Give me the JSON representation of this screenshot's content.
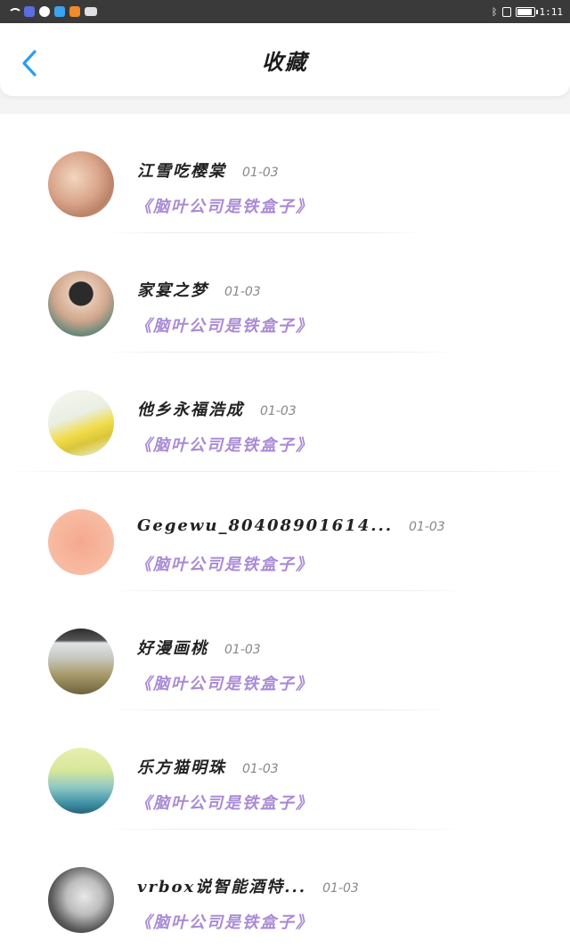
{
  "status_bar": {
    "time": "1:11",
    "app_icons": [
      "#5b6de0",
      "#ffffff",
      "#3aa4f0",
      "#f08a2a",
      "#e0e0e0"
    ]
  },
  "header": {
    "title": "收藏",
    "back_icon": "chevron-left-icon",
    "accent": "#2a9df4"
  },
  "favorites": [
    {
      "name": "江雪吃樱棠",
      "date": "01-03",
      "book": "《脑叶公司是铁盒子》"
    },
    {
      "name": "家宴之梦",
      "date": "01-03",
      "book": "《脑叶公司是铁盒子》"
    },
    {
      "name": "他乡永福浩成",
      "date": "01-03",
      "book": "《脑叶公司是铁盒子》"
    },
    {
      "name": "Gegewu_80408901614...",
      "date": "01-03",
      "book": "《脑叶公司是铁盒子》"
    },
    {
      "name": "好漫画桃",
      "date": "01-03",
      "book": "《脑叶公司是铁盒子》"
    },
    {
      "name": "乐方猫明珠",
      "date": "01-03",
      "book": "《脑叶公司是铁盒子》"
    },
    {
      "name": "vrbox说智能酒特...",
      "date": "01-03",
      "book": "《脑叶公司是铁盒子》"
    }
  ],
  "colors": {
    "book_purple": "#a98ad4",
    "name_dark": "#222222",
    "date_gray": "#888888"
  }
}
